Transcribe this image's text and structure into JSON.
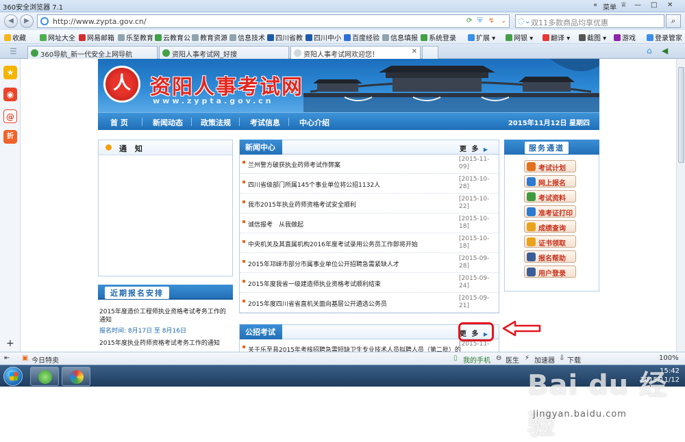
{
  "browser": {
    "title": "360安全浏览器 7.1",
    "menu_label": "菜单",
    "url": "http://www.zypta.gov.cn/",
    "search_placeholder": "双11多款商品均享优惠"
  },
  "bookmarks": [
    {
      "label": "收藏",
      "color": "#f3b51c"
    },
    {
      "label": "网址大全",
      "color": "#4caf50"
    },
    {
      "label": "网易邮箱",
      "color": "#d32f2f"
    },
    {
      "label": "乐至教育",
      "color": "#90a4ae"
    },
    {
      "label": "云教育公",
      "color": "#43a047"
    },
    {
      "label": "教育资源",
      "color": "#90a4ae"
    },
    {
      "label": "信息技术",
      "color": "#90a4ae"
    },
    {
      "label": "四川省教",
      "color": "#1e5aa8"
    },
    {
      "label": "四川中小",
      "color": "#1e5aa8"
    },
    {
      "label": "百度经验",
      "color": "#2f6fd6"
    },
    {
      "label": "信息填报",
      "color": "#90a4ae"
    },
    {
      "label": "系统登录",
      "color": "#43a047"
    },
    {
      "label": "扩展",
      "color": "#3a8ee6"
    },
    {
      "label": "网银",
      "color": "#43a047"
    },
    {
      "label": "翻译",
      "color": "#e53935"
    },
    {
      "label": "截图",
      "color": "#555555"
    },
    {
      "label": "游戏",
      "color": "#8e24aa"
    },
    {
      "label": "登录管家",
      "color": "#3a8ee6"
    }
  ],
  "tabs": [
    {
      "label": "360导航_新一代安全上网导航",
      "color": "#43a047"
    },
    {
      "label": "资阳人事考试网_好搜",
      "color": "#43a047"
    },
    {
      "label": "资阳人事考试网欢迎您！",
      "color": "#90a4ae"
    }
  ],
  "site": {
    "logo_char": "人",
    "name": "资阳人事考试网",
    "url_text": "www.zypta.gov.cn",
    "nav": [
      "首  页",
      "新闻动态",
      "政策法规",
      "考试信息",
      "中心介绍"
    ],
    "date": "2015年11月12日  星期四"
  },
  "notice": {
    "title": "通 知"
  },
  "recent": {
    "title": "近期报名安排",
    "items": [
      {
        "title": "2015年度造价工程师执业资格考试考务工作的通知",
        "meta": "报名时间:  8月17日  至  8月16日"
      },
      {
        "title": "2015年度执业药师资格考试考务工作的通知"
      }
    ]
  },
  "news": {
    "title": "新闻中心",
    "more": "更 多",
    "items": [
      {
        "title": "兰州警方破获执业药师考试作弊案",
        "date": "[2015-11-09]"
      },
      {
        "title": "四川省级部门所属145个事业单位将公招1132人",
        "date": "[2015-10-28]"
      },
      {
        "title": "我市2015年执业药师资格考试安全顺利",
        "date": "[2015-10-22]"
      },
      {
        "title": "诚信报考　从我做起",
        "date": "[2015-10-18]"
      },
      {
        "title": "中央机关及其直属机构2016年度考试录用公务员工作即将开始",
        "date": "[2015-10-18]"
      },
      {
        "title": "2015年邛崃市部分市属事业单位公开招聘急需紧缺人才",
        "date": "[2015-09-28]"
      },
      {
        "title": "2015年度我省一级建造师执业资格考试顺利结束",
        "date": "[2015-09-24]"
      },
      {
        "title": "2015年度四川省省直机关面向基层公开遴选公务员",
        "date": "[2015-09-21]"
      }
    ]
  },
  "exams": {
    "title": "公招考试",
    "more": "更 多",
    "items": [
      {
        "title": "关于乐至县2015年考核招聘急需短缺卫生专业技术人员拟聘人员（第二批）的",
        "date": "[2015-11-"
      }
    ]
  },
  "services": {
    "title": "服务通道",
    "items": [
      {
        "label": "考试计划",
        "color": "#e2711d"
      },
      {
        "label": "网上报名",
        "color": "#2c7bd0"
      },
      {
        "label": "考试资料",
        "color": "#3f9b3f"
      },
      {
        "label": "准考证打印",
        "color": "#2c7bd0"
      },
      {
        "label": "成绩查询",
        "color": "#e9a21b"
      },
      {
        "label": "证书领取",
        "color": "#e9a21b"
      },
      {
        "label": "报名帮助",
        "color": "#3b5e99"
      },
      {
        "label": "用户登录",
        "color": "#3b5e99"
      }
    ]
  },
  "statusbar": {
    "today": "今日特卖",
    "phone": "我的手机",
    "doctor": "医生",
    "accelerator": "加速器",
    "download": "下载",
    "zoom": "100%"
  },
  "taskbar": {
    "time": "15:42",
    "date": "2015/11/12"
  },
  "watermark": {
    "brand": "Bai du 经验",
    "url": "jingyan.baidu.com"
  }
}
